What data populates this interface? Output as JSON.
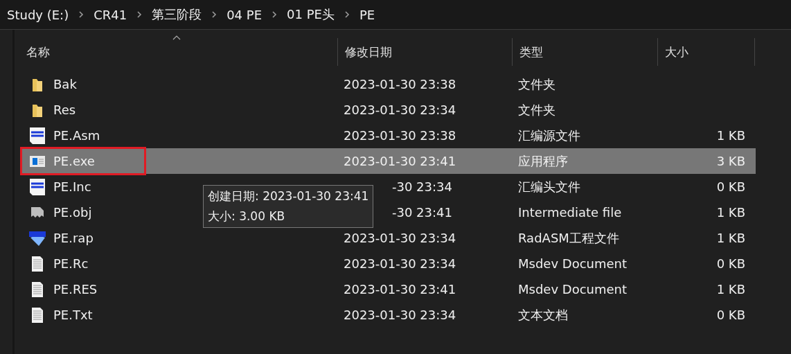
{
  "breadcrumb": [
    "Study (E:)",
    "CR41",
    "第三阶段",
    "04 PE",
    "01 PE头",
    "PE"
  ],
  "columns": [
    {
      "label": "名称",
      "sorted": true
    },
    {
      "label": "修改日期",
      "sorted": false
    },
    {
      "label": "类型",
      "sorted": false
    },
    {
      "label": "大小",
      "sorted": false
    }
  ],
  "rows": [
    {
      "kind": "folder",
      "name": "Bak",
      "date": "2023-01-30 23:38",
      "type": "文件夹",
      "size": "",
      "selected": false,
      "covered": false
    },
    {
      "kind": "folder",
      "name": "Res",
      "date": "2023-01-30 23:34",
      "type": "文件夹",
      "size": "",
      "selected": false,
      "covered": false
    },
    {
      "kind": "asm",
      "name": "PE.Asm",
      "date": "2023-01-30 23:38",
      "type": "汇编源文件",
      "size": "1 KB",
      "selected": false,
      "covered": false
    },
    {
      "kind": "exe",
      "name": "PE.exe",
      "date": "2023-01-30 23:41",
      "type": "应用程序",
      "size": "3 KB",
      "selected": true,
      "covered": false
    },
    {
      "kind": "inc",
      "name": "PE.Inc",
      "date": "-30 23:34",
      "type": "汇编头文件",
      "size": "0 KB",
      "selected": false,
      "covered": true
    },
    {
      "kind": "obj",
      "name": "PE.obj",
      "date": "-30 23:41",
      "type": "Intermediate file",
      "size": "1 KB",
      "selected": false,
      "covered": true
    },
    {
      "kind": "rap",
      "name": "PE.rap",
      "date": "2023-01-30 23:34",
      "type": "RadASM工程文件",
      "size": "1 KB",
      "selected": false,
      "covered": false
    },
    {
      "kind": "doc",
      "name": "PE.Rc",
      "date": "2023-01-30 23:34",
      "type": "Msdev Document",
      "size": "0 KB",
      "selected": false,
      "covered": false
    },
    {
      "kind": "doc",
      "name": "PE.RES",
      "date": "2023-01-30 23:41",
      "type": "Msdev Document",
      "size": "1 KB",
      "selected": false,
      "covered": false
    },
    {
      "kind": "doc",
      "name": "PE.Txt",
      "date": "2023-01-30 23:34",
      "type": "文本文档",
      "size": "0 KB",
      "selected": false,
      "covered": false
    }
  ],
  "tooltip": [
    "创建日期: 2023-01-30 23:41",
    "大小: 3.00 KB"
  ]
}
